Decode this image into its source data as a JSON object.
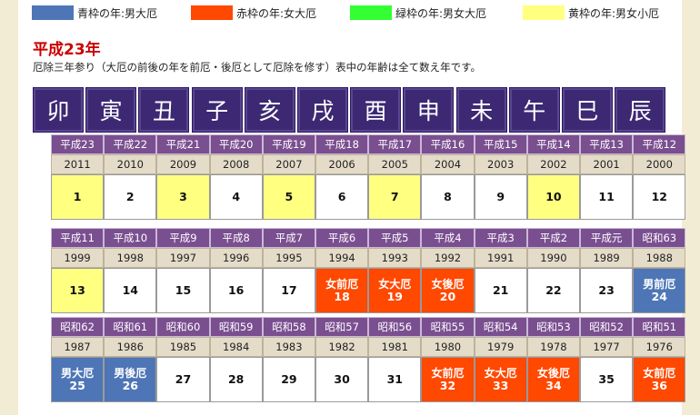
{
  "legend": [
    {
      "label": "青枠の年:男大厄",
      "color": "#4e76b6"
    },
    {
      "label": "赤枠の年:女大厄",
      "color": "#ff4800"
    },
    {
      "label": "緑枠の年:男女大厄",
      "color": "#33ff33"
    },
    {
      "label": "黄枠の年:男女小厄",
      "color": "#ffff80"
    }
  ],
  "title": "平成23年",
  "note": "厄除三年参り（大厄の前後の年を前厄・後厄として厄除を修す）表中の年齢は全て数え年です。",
  "zodiac": [
    "卯",
    "寅",
    "丑",
    "子",
    "亥",
    "戌",
    "酉",
    "申",
    "未",
    "午",
    "巳",
    "辰"
  ],
  "blocks": [
    {
      "eras": [
        "平成23",
        "平成22",
        "平成21",
        "平成20",
        "平成19",
        "平成18",
        "平成17",
        "平成16",
        "平成15",
        "平成14",
        "平成13",
        "平成12"
      ],
      "years": [
        "2011",
        "2010",
        "2009",
        "2008",
        "2007",
        "2006",
        "2005",
        "2004",
        "2003",
        "2002",
        "2001",
        "2000"
      ],
      "ages": [
        {
          "label": "",
          "age": "1",
          "type": "yellow"
        },
        {
          "label": "",
          "age": "2",
          "type": "white"
        },
        {
          "label": "",
          "age": "3",
          "type": "yellow"
        },
        {
          "label": "",
          "age": "4",
          "type": "white"
        },
        {
          "label": "",
          "age": "5",
          "type": "yellow"
        },
        {
          "label": "",
          "age": "6",
          "type": "white"
        },
        {
          "label": "",
          "age": "7",
          "type": "yellow"
        },
        {
          "label": "",
          "age": "8",
          "type": "white"
        },
        {
          "label": "",
          "age": "9",
          "type": "white"
        },
        {
          "label": "",
          "age": "10",
          "type": "yellow"
        },
        {
          "label": "",
          "age": "11",
          "type": "white"
        },
        {
          "label": "",
          "age": "12",
          "type": "white"
        }
      ]
    },
    {
      "eras": [
        "平成11",
        "平成10",
        "平成9",
        "平成8",
        "平成7",
        "平成6",
        "平成5",
        "平成4",
        "平成3",
        "平成2",
        "平成元",
        "昭和63"
      ],
      "years": [
        "1999",
        "1998",
        "1997",
        "1996",
        "1995",
        "1994",
        "1993",
        "1992",
        "1991",
        "1990",
        "1989",
        "1988"
      ],
      "ages": [
        {
          "label": "",
          "age": "13",
          "type": "yellow"
        },
        {
          "label": "",
          "age": "14",
          "type": "white"
        },
        {
          "label": "",
          "age": "15",
          "type": "white"
        },
        {
          "label": "",
          "age": "16",
          "type": "white"
        },
        {
          "label": "",
          "age": "17",
          "type": "white"
        },
        {
          "label": "女前厄",
          "age": "18",
          "type": "red"
        },
        {
          "label": "女大厄",
          "age": "19",
          "type": "red"
        },
        {
          "label": "女後厄",
          "age": "20",
          "type": "red"
        },
        {
          "label": "",
          "age": "21",
          "type": "white"
        },
        {
          "label": "",
          "age": "22",
          "type": "white"
        },
        {
          "label": "",
          "age": "23",
          "type": "white"
        },
        {
          "label": "男前厄",
          "age": "24",
          "type": "blue"
        }
      ]
    },
    {
      "eras": [
        "昭和62",
        "昭和61",
        "昭和60",
        "昭和59",
        "昭和58",
        "昭和57",
        "昭和56",
        "昭和55",
        "昭和54",
        "昭和53",
        "昭和52",
        "昭和51"
      ],
      "years": [
        "1987",
        "1986",
        "1985",
        "1984",
        "1983",
        "1982",
        "1981",
        "1980",
        "1979",
        "1978",
        "1977",
        "1976"
      ],
      "ages": [
        {
          "label": "男大厄",
          "age": "25",
          "type": "blue"
        },
        {
          "label": "男後厄",
          "age": "26",
          "type": "blue"
        },
        {
          "label": "",
          "age": "27",
          "type": "white"
        },
        {
          "label": "",
          "age": "28",
          "type": "white"
        },
        {
          "label": "",
          "age": "29",
          "type": "white"
        },
        {
          "label": "",
          "age": "30",
          "type": "white"
        },
        {
          "label": "",
          "age": "31",
          "type": "white"
        },
        {
          "label": "女前厄",
          "age": "32",
          "type": "red"
        },
        {
          "label": "女大厄",
          "age": "33",
          "type": "red"
        },
        {
          "label": "女後厄",
          "age": "34",
          "type": "red"
        },
        {
          "label": "",
          "age": "35",
          "type": "white"
        },
        {
          "label": "女前厄",
          "age": "36",
          "type": "red"
        }
      ]
    }
  ]
}
